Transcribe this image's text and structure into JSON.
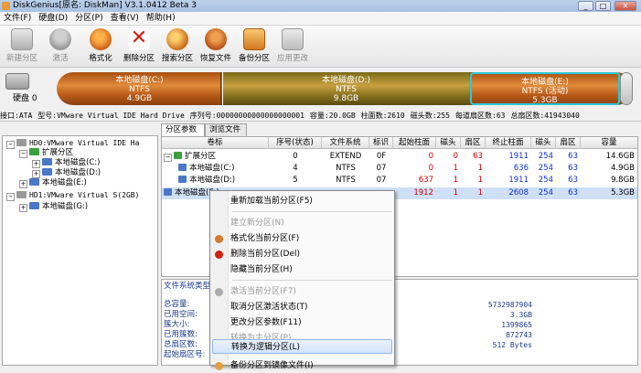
{
  "window": {
    "title": "DiskGenius[原名: DiskMan] V3.1.0412 Beta 3",
    "minimize": "_",
    "maximize": "□",
    "close": "✕"
  },
  "menu": [
    "文件(F)",
    "硬盘(D)",
    "分区(P)",
    "查看(V)",
    "帮助(H)"
  ],
  "toolbar": [
    {
      "label": "新建分区",
      "icon": "new-partition-icon",
      "enabled": false
    },
    {
      "label": "激活",
      "icon": "activate-icon",
      "enabled": false
    },
    {
      "label": "格式化",
      "icon": "format-icon",
      "enabled": true
    },
    {
      "label": "删除分区",
      "icon": "delete-partition-icon",
      "enabled": true
    },
    {
      "label": "搜索分区",
      "icon": "search-partition-icon",
      "enabled": true
    },
    {
      "label": "恢复文件",
      "icon": "recover-files-icon",
      "enabled": true
    },
    {
      "label": "备份分区",
      "icon": "backup-partition-icon",
      "enabled": true
    },
    {
      "label": "应用更改",
      "icon": "apply-changes-icon",
      "enabled": false
    }
  ],
  "disk_map": {
    "label": "硬盘 0",
    "partitions": [
      {
        "name": "本地磁盘(C:)",
        "fs": "NTFS",
        "size": "4.9GB"
      },
      {
        "name": "本地磁盘(D:)",
        "fs": "NTFS",
        "size": "9.8GB"
      },
      {
        "name": "本地磁盘(E:)",
        "fs": "NTFS (活动)",
        "size": "5.3GB"
      }
    ]
  },
  "disk_info": {
    "interface": "接口:ATA",
    "model": "型号:VMware Virtual IDE Hard Drive",
    "serial": "序列号:00000000000000000001",
    "capacity": "容量:20.0GB",
    "cylinders": "柱面数:2610",
    "heads": "磁头数:255",
    "sectors_per_track": "每道扇区数:63",
    "total_sectors": "总扇区数:41943040"
  },
  "tree": {
    "disk0": "HD0:VMware Virtual IDE Ha",
    "extended": "扩展分区",
    "c": "本地磁盘(C:)",
    "d": "本地磁盘(D:)",
    "e": "本地磁盘(E:)",
    "disk1": "HD1:VMware Virtual S(2GB)",
    "g": "本地磁盘(G:)"
  },
  "tabs": [
    "分区参数",
    "浏览文件"
  ],
  "table": {
    "columns": [
      "卷标",
      "序号(状态)",
      "文件系统",
      "标识",
      "起始柱面",
      "磁头",
      "扇区",
      "终止柱面",
      "磁头",
      "扇区",
      "容量"
    ],
    "rows": [
      [
        "扩展分区",
        "0",
        "EXTEND",
        "0F",
        "0",
        "0",
        "63",
        "1911",
        "254",
        "63",
        "14.6GB"
      ],
      [
        "本地磁盘(C:)",
        "4",
        "NTFS",
        "07",
        "0",
        "1",
        "1",
        "636",
        "254",
        "63",
        "4.9GB"
      ],
      [
        "本地磁盘(D:)",
        "5",
        "NTFS",
        "07",
        "637",
        "1",
        "1",
        "1911",
        "254",
        "63",
        "9.8GB"
      ],
      [
        "本地磁盘(E:)",
        "",
        "",
        "",
        "1912",
        "1",
        "1",
        "2608",
        "254",
        "63",
        "5.3GB"
      ]
    ]
  },
  "details": {
    "section": "文件系统类型",
    "labels": [
      "总容量:",
      "已用空间:",
      "簇大小:",
      "已用簇数:",
      "总扇区数:",
      "起始扇区号:"
    ],
    "values": [
      "5732987904",
      "3.3GB",
      "1399865",
      "872743",
      "512 Bytes"
    ]
  },
  "context_menu": [
    {
      "label": "重新加载当前分区(F5)",
      "enabled": true,
      "icon": ""
    },
    {
      "sep": true
    },
    {
      "label": "建立新分区(N)",
      "enabled": false,
      "icon": ""
    },
    {
      "label": "格式化当前分区(F)",
      "enabled": true,
      "icon": "format-icon"
    },
    {
      "label": "删除当前分区(Del)",
      "enabled": true,
      "icon": "delete-icon"
    },
    {
      "label": "隐藏当前分区(H)",
      "enabled": true,
      "icon": ""
    },
    {
      "sep": true
    },
    {
      "label": "激活当前分区(F7)",
      "enabled": false,
      "icon": "activate-icon"
    },
    {
      "label": "取消分区激活状态(T)",
      "enabled": true,
      "icon": ""
    },
    {
      "label": "更改分区参数(F11)",
      "enabled": true,
      "icon": ""
    },
    {
      "label": "转换为主分区(P)",
      "enabled": false,
      "icon": ""
    },
    {
      "label": "转换为逻辑分区(L)",
      "enabled": true,
      "icon": "",
      "highlight": true
    },
    {
      "sep": true
    },
    {
      "label": "备份分区到镜像文件(I)",
      "enabled": true,
      "icon": "backup-icon"
    }
  ],
  "colors": {
    "disk_orange": "#c86a1a",
    "selected_cyan": "#2ac8d8",
    "link_blue": "#1030c8",
    "num_red": "#d00000"
  }
}
